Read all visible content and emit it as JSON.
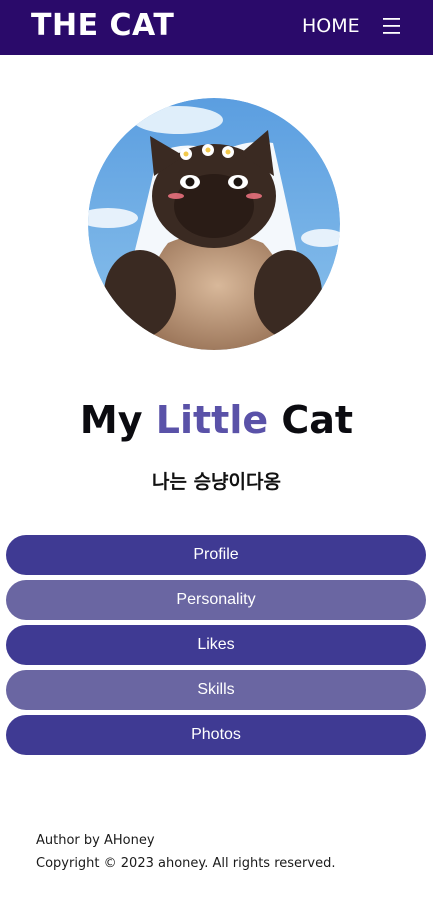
{
  "header": {
    "brand": "THE CAT",
    "nav_home": "HOME",
    "menu_icon": "hamburger-menu-icon",
    "bg_color": "#2a0a6a"
  },
  "hero": {
    "image": "cat-photo-avatar",
    "title_part1": "My ",
    "title_accent": "Little",
    "title_part2": " Cat",
    "accent_color": "#5a52a8",
    "subtitle": "나는 승냥이다옹"
  },
  "menu": {
    "items": [
      {
        "label": "Profile"
      },
      {
        "label": "Personality"
      },
      {
        "label": "Likes"
      },
      {
        "label": "Skills"
      },
      {
        "label": "Photos"
      }
    ],
    "dark_color": "#3f3a93",
    "light_color": "#6a66a2"
  },
  "footer": {
    "author": "Author by AHoney",
    "copyright": "Copyright © 2023 ahoney. All rights reserved."
  }
}
